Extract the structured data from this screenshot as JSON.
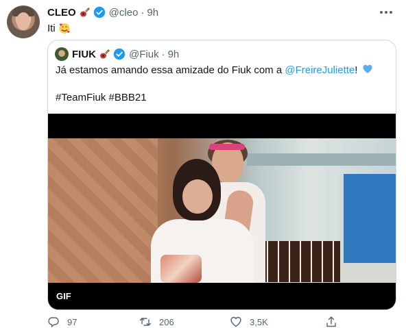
{
  "tweet": {
    "author_name": "CLEO",
    "author_handle": "@cleo",
    "separator": "·",
    "time": "9h",
    "text": "Iti",
    "icons": {
      "name_emoji": "guitar-icon",
      "verified": "verified-badge-icon",
      "text_emoji": "smiling-face-with-hearts-icon",
      "more": "more-options-icon"
    }
  },
  "quote": {
    "author_name": "FIUK",
    "author_handle": "@Fiuk",
    "separator": "·",
    "time": "9h",
    "text_before": "Já estamos amando essa amizade do Fiuk com a ",
    "mention": "@FreireJuliette",
    "text_after": "!",
    "hashtags": "#TeamFiuk #BBB21",
    "media_label": "GIF",
    "icons": {
      "heart_emoji": "blue-heart-icon"
    }
  },
  "actions": {
    "reply_count": "97",
    "retweet_count": "206",
    "like_count": "3,5K"
  },
  "colors": {
    "accent": "#1d9bf0",
    "text_secondary": "#536471",
    "border": "#cfd9de"
  }
}
